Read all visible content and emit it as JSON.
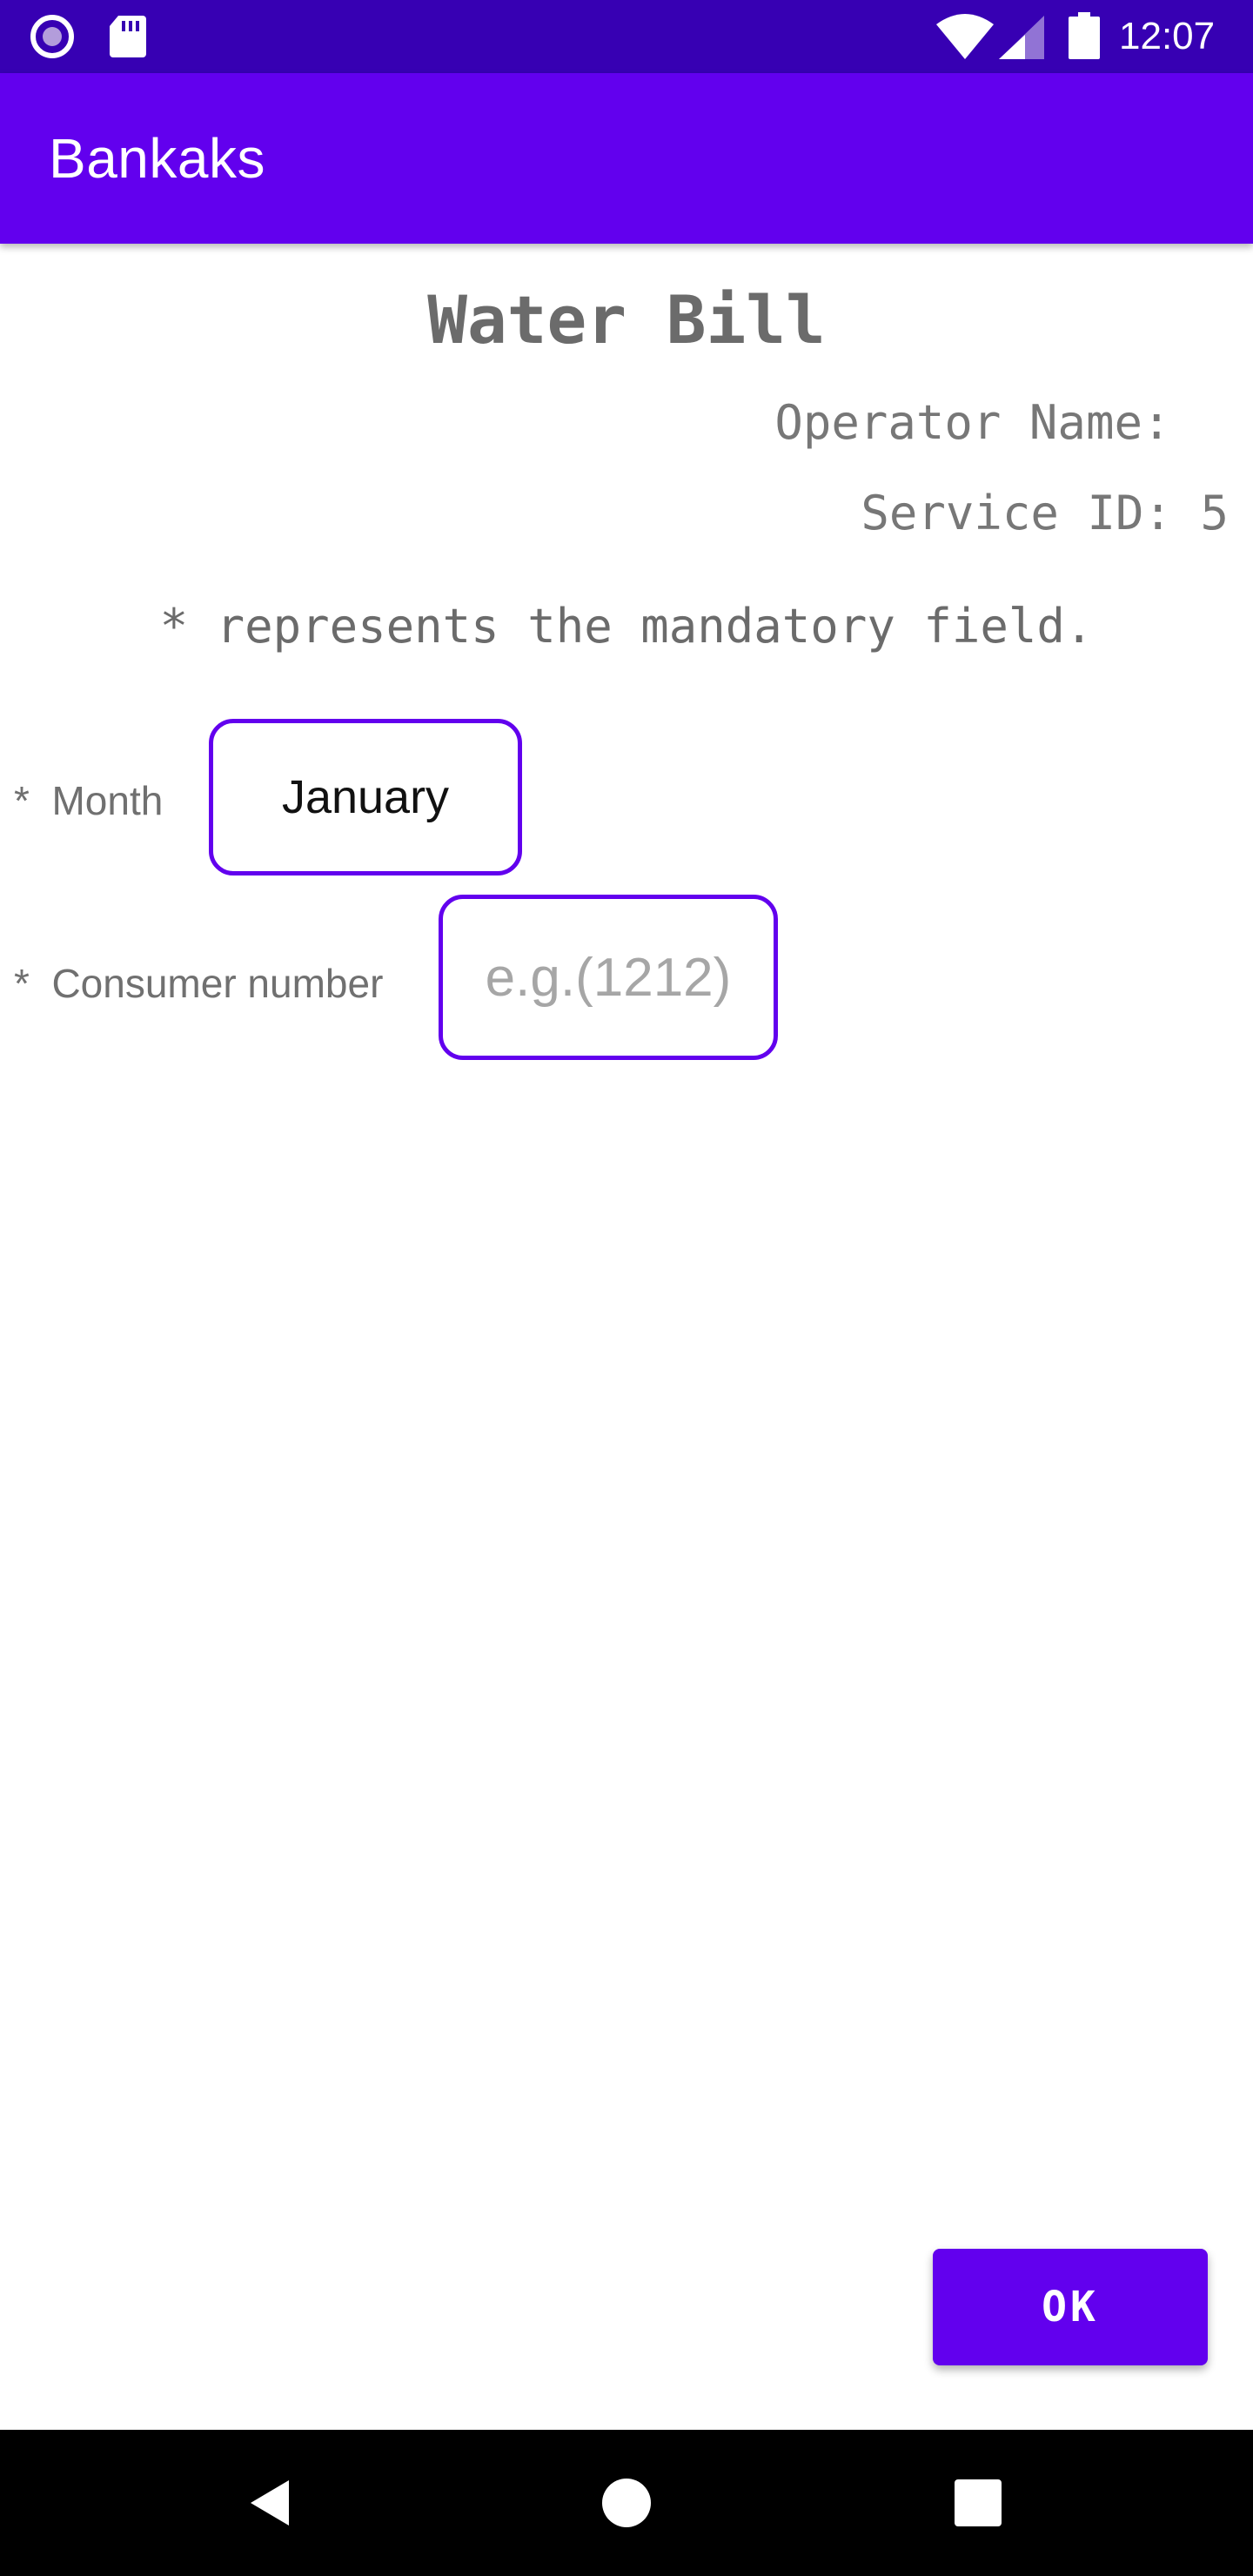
{
  "status_bar": {
    "time": "12:07",
    "icons": [
      "screen-record-icon",
      "sd-card-icon",
      "wifi-icon",
      "cell-signal-icon",
      "battery-icon"
    ],
    "color": "#3700b3"
  },
  "app_bar": {
    "title": "Bankaks",
    "color": "#6200ee"
  },
  "page": {
    "title": "Water Bill",
    "operator_name": "Operator Name: ",
    "service_id": "Service ID: 5",
    "mandatory_note": "* represents the mandatory field."
  },
  "form": {
    "month": {
      "label": "*  Month",
      "value": "January"
    },
    "consumer_number": {
      "label": "*  Consumer number",
      "value": "",
      "placeholder": "e.g.(1212)"
    },
    "ok_label": "OK"
  },
  "nav_bar": {
    "icons": [
      "back-icon",
      "home-icon",
      "recents-icon"
    ]
  },
  "colors": {
    "primary": "#6200ee",
    "primary_dark": "#3700b3"
  }
}
